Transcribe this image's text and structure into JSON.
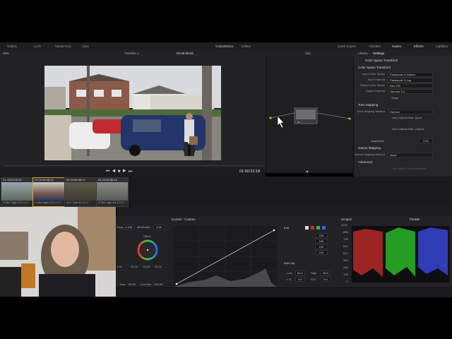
{
  "topbar": {
    "left_items": [
      "Gallery",
      "LUTs",
      "Media Pool",
      "Clips"
    ],
    "project": "ColourDemo",
    "status": "Edited",
    "right_items": [
      "Quick Export",
      "Timeline",
      "Nodes",
      "Effects",
      "Lightbox"
    ]
  },
  "viewer_bar": {
    "zoom": "39%",
    "timeline": "Timeline 1",
    "timecode": "00:45:08:04",
    "mode": "Clip"
  },
  "transport": {
    "timecode": "01:00:23:18"
  },
  "clips": [
    {
      "num": "01",
      "tc": "23:03:16:22",
      "codec": "H.264 High 4:2:2 L5.1"
    },
    {
      "num": "02",
      "tc": "00:45:08:04",
      "codec": "H.264 High 4:2:2 L5.1"
    },
    {
      "num": "03",
      "tc": "00:55:06:17",
      "codec": "AVC Intra 4K 4:2:2"
    },
    {
      "num": "04",
      "tc": "23:48:56:16",
      "codec": "H.264 High 4:2:2 L5.1"
    }
  ],
  "node": {
    "label": "01"
  },
  "inspector": {
    "tabs": [
      "Library",
      "Settings"
    ],
    "title": "Color Space Transform",
    "section1": "Color Space Transform",
    "rows": [
      {
        "label": "Input Color Space",
        "value": "Panasonic V-Gamut"
      },
      {
        "label": "Input Gamma",
        "value": "Panasonic V-Log"
      },
      {
        "label": "Output Color Space",
        "value": "Rec.709"
      },
      {
        "label": "Output Gamma",
        "value": "Gamma 2.4"
      }
    ],
    "swap": "Swap",
    "section2": "Tone Mapping",
    "tone_method_label": "Tone Mapping Method",
    "tone_method": "DaVinci",
    "max_input": "Use Custom Max. Input",
    "max_output": "Use Custom Max. Output",
    "adaptation_label": "Adaptation",
    "adaptation": "9.00",
    "section3": "Gamut Mapping",
    "gamut_method_label": "Gamut Mapping Method",
    "gamut_method": "None",
    "section4": "Advanced",
    "footnote": "Use White Point Adaptation"
  },
  "curves": {
    "left_panel": {
      "temp_label": "Temp",
      "temp": "0.435",
      "mid_label": "Mid/Detail",
      "mid": "0.00",
      "offset": "Offset",
      "vals": [
        "25.00",
        "25.00",
        "25.00"
      ],
      "left_val": "1.00",
      "bottom": [
        "Hue",
        "50.00",
        "Lum Mix",
        "100.00"
      ]
    },
    "title": "Curves - Custom",
    "edit_label": "Edit",
    "edit_vals": [
      "100",
      "100",
      "100",
      "100"
    ],
    "softclip": "Soft Clip",
    "low_label": "Low",
    "low": "50.0",
    "high_label": "High",
    "high": "50.0",
    "ls_label": "L.S.",
    "ls": "0.0",
    "hs_label": "H.S.",
    "hs": "0.0"
  },
  "scopes": {
    "title": "Scopes",
    "mode": "Parade",
    "axis": [
      "1023",
      "896",
      "768",
      "640",
      "512",
      "384",
      "256",
      "128",
      "0"
    ]
  },
  "colors": {
    "accent": "#d8a830",
    "panel": "#222225",
    "red": "#d03030",
    "green": "#30c030",
    "blue": "#3060e0"
  }
}
